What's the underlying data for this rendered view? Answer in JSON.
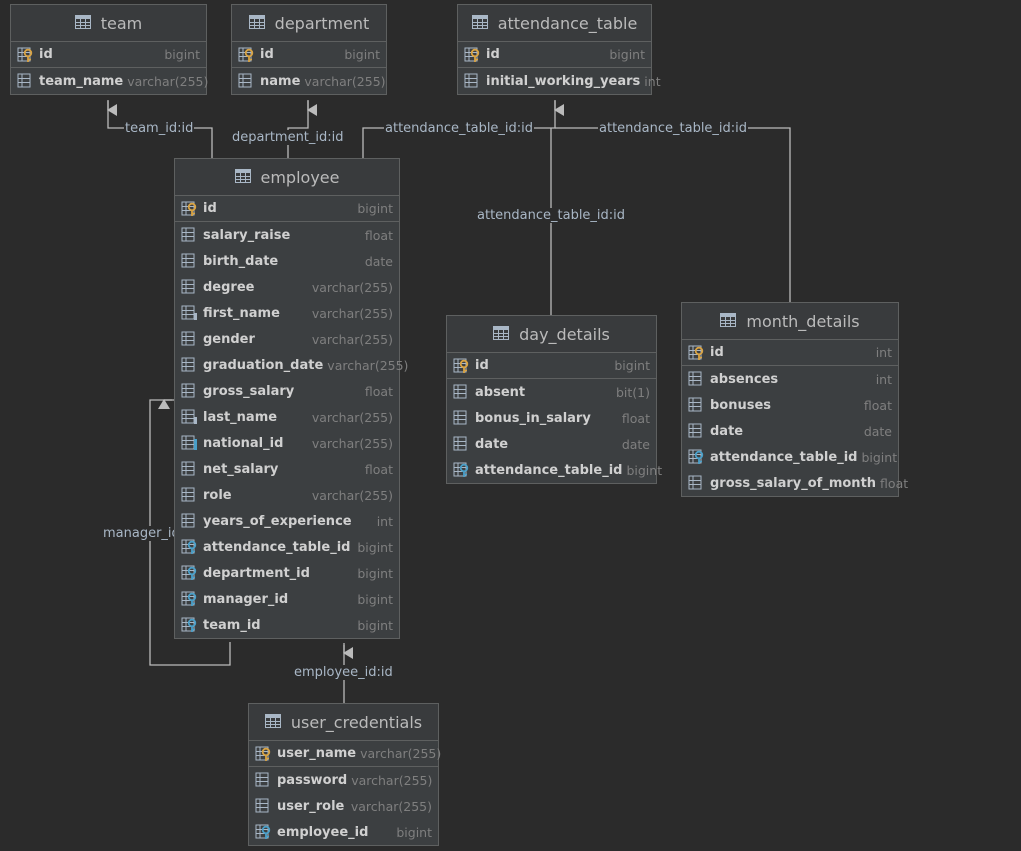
{
  "colors": {
    "background": "#2b2b2b",
    "entity_bg": "#3c3f41",
    "border": "#5e6060",
    "key_gold": "#d9a343",
    "key_blue": "#4a9fc8",
    "line": "#bbbbbb"
  },
  "relations": {
    "team_fk": "team_id:id",
    "department_fk": "department_id:id",
    "attendance_fk": "attendance_table_id:id",
    "month_fk": "attendance_table_id:id",
    "day_fk": "attendance_table_id:id",
    "manager_fk": "manager_id",
    "employee_fk": "employee_id:id"
  },
  "tables": {
    "team": {
      "title": "team",
      "columns": [
        {
          "name": "id",
          "type": "bigint",
          "icon": "pk"
        },
        {
          "name": "team_name",
          "type": "varchar(255)",
          "icon": "col"
        }
      ]
    },
    "department": {
      "title": "department",
      "columns": [
        {
          "name": "id",
          "type": "bigint",
          "icon": "pk"
        },
        {
          "name": "name",
          "type": "varchar(255)",
          "icon": "col"
        }
      ]
    },
    "attendance_table": {
      "title": "attendance_table",
      "columns": [
        {
          "name": "id",
          "type": "bigint",
          "icon": "pk"
        },
        {
          "name": "initial_working_years",
          "type": "int",
          "icon": "col"
        }
      ]
    },
    "employee": {
      "title": "employee",
      "columns": [
        {
          "name": "id",
          "type": "bigint",
          "icon": "pk"
        },
        {
          "name": "salary_raise",
          "type": "float",
          "icon": "col"
        },
        {
          "name": "birth_date",
          "type": "date",
          "icon": "col"
        },
        {
          "name": "degree",
          "type": "varchar(255)",
          "icon": "col"
        },
        {
          "name": "first_name",
          "type": "varchar(255)",
          "icon": "col-ix"
        },
        {
          "name": "gender",
          "type": "varchar(255)",
          "icon": "col"
        },
        {
          "name": "graduation_date",
          "type": "varchar(255)",
          "icon": "col"
        },
        {
          "name": "gross_salary",
          "type": "float",
          "icon": "col"
        },
        {
          "name": "last_name",
          "type": "varchar(255)",
          "icon": "col-ix"
        },
        {
          "name": "national_id",
          "type": "varchar(255)",
          "icon": "col-uq"
        },
        {
          "name": "net_salary",
          "type": "float",
          "icon": "col"
        },
        {
          "name": "role",
          "type": "varchar(255)",
          "icon": "col"
        },
        {
          "name": "years_of_experience",
          "type": "int",
          "icon": "col"
        },
        {
          "name": "attendance_table_id",
          "type": "bigint",
          "icon": "fk"
        },
        {
          "name": "department_id",
          "type": "bigint",
          "icon": "fk"
        },
        {
          "name": "manager_id",
          "type": "bigint",
          "icon": "fk"
        },
        {
          "name": "team_id",
          "type": "bigint",
          "icon": "fk"
        }
      ]
    },
    "day_details": {
      "title": "day_details",
      "columns": [
        {
          "name": "id",
          "type": "bigint",
          "icon": "pk"
        },
        {
          "name": "absent",
          "type": "bit(1)",
          "icon": "col"
        },
        {
          "name": "bonus_in_salary",
          "type": "float",
          "icon": "col"
        },
        {
          "name": "date",
          "type": "date",
          "icon": "col"
        },
        {
          "name": "attendance_table_id",
          "type": "bigint",
          "icon": "fk"
        }
      ]
    },
    "month_details": {
      "title": "month_details",
      "columns": [
        {
          "name": "id",
          "type": "int",
          "icon": "pk"
        },
        {
          "name": "absences",
          "type": "int",
          "icon": "col"
        },
        {
          "name": "bonuses",
          "type": "float",
          "icon": "col"
        },
        {
          "name": "date",
          "type": "date",
          "icon": "col"
        },
        {
          "name": "attendance_table_id",
          "type": "bigint",
          "icon": "fk"
        },
        {
          "name": "gross_salary_of_month",
          "type": "float",
          "icon": "col"
        }
      ]
    },
    "user_credentials": {
      "title": "user_credentials",
      "columns": [
        {
          "name": "user_name",
          "type": "varchar(255)",
          "icon": "pk"
        },
        {
          "name": "password",
          "type": "varchar(255)",
          "icon": "col"
        },
        {
          "name": "user_role",
          "type": "varchar(255)",
          "icon": "col"
        },
        {
          "name": "employee_id",
          "type": "bigint",
          "icon": "fk"
        }
      ]
    }
  }
}
